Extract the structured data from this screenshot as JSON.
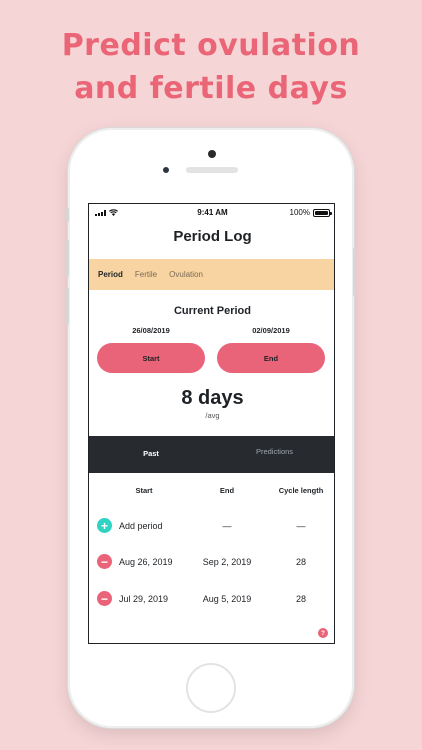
{
  "headline": {
    "line1": "Predict ovulation",
    "line2": "and fertile days"
  },
  "status_bar": {
    "time": "9:41 AM",
    "battery": "100%"
  },
  "page_title": "Period Log",
  "tabs": [
    {
      "label": "Period",
      "active": true
    },
    {
      "label": "Fertile",
      "active": false
    },
    {
      "label": "Ovulation",
      "active": false
    }
  ],
  "current_period": {
    "title": "Current Period",
    "start_date": "26/08/2019",
    "end_date": "02/09/2019",
    "start_label": "Start",
    "end_label": "End",
    "avg_value": "8 days",
    "avg_unit": "/avg"
  },
  "history_tabs": {
    "past": "Past",
    "predictions": "Predictions"
  },
  "table": {
    "headers": {
      "start": "Start",
      "end": "End",
      "cycle": "Cycle length"
    },
    "add_row": {
      "label": "Add period",
      "end": "—",
      "cycle": "—"
    },
    "rows": [
      {
        "start": "Aug 26, 2019",
        "end": "Sep 2, 2019",
        "cycle": "28"
      },
      {
        "start": "Jul 29, 2019",
        "end": "Aug 5, 2019",
        "cycle": "28"
      }
    ]
  },
  "help_label": "?",
  "icons": {
    "add": "plus-icon",
    "remove": "minus-icon",
    "signal": "signal-icon",
    "wifi": "wifi-icon",
    "battery": "battery-icon"
  },
  "colors": {
    "background": "#f6d5d6",
    "accent": "#ea6479",
    "tab_bar": "#f8d4a2",
    "dark": "#272b30",
    "add": "#2fd3c2"
  }
}
